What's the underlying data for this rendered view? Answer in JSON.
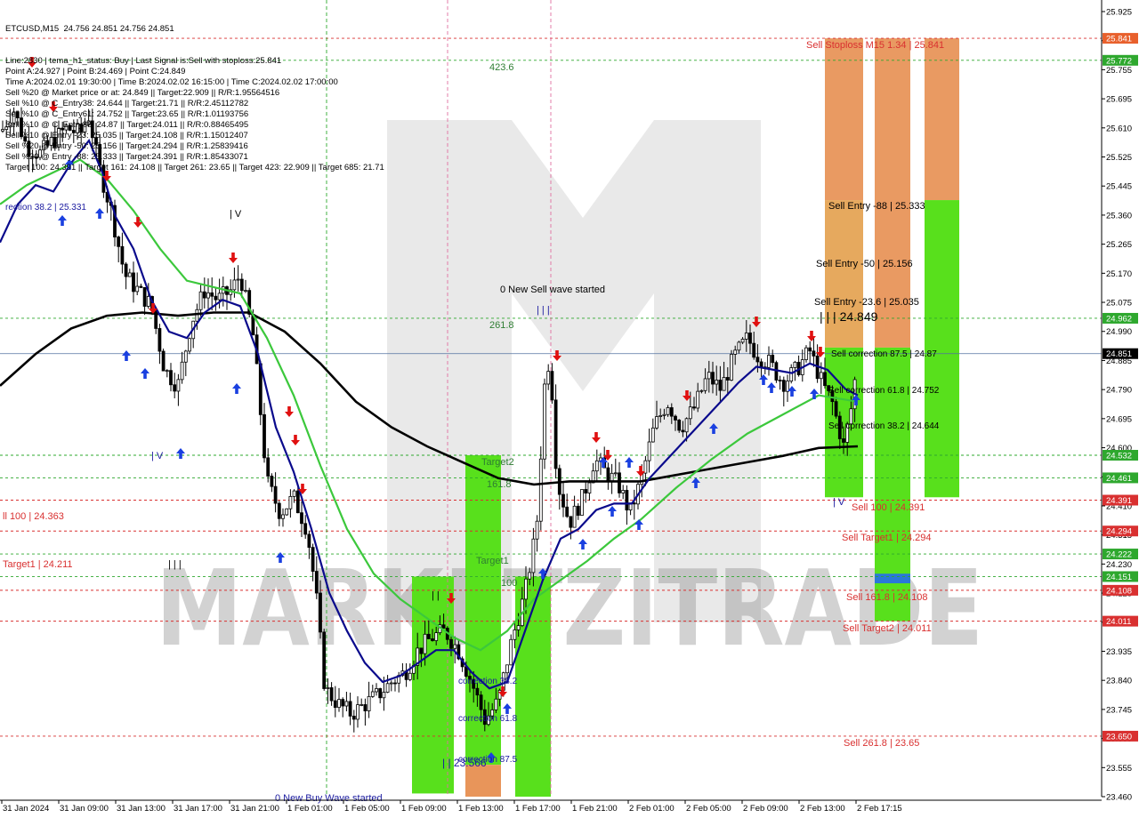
{
  "header": {
    "symbol_line": "ETCUSD,M15  24.756 24.851 24.756 24.851",
    "info_lines": [
      "Line:2830 | tema_h1_status: Buy | Last Signal is:Sell with stoploss:25.841",
      "Point A:24.927 | Point B:24.469 | Point C:24.849",
      "Time A:2024.02.01 19:30:00 | Time B:2024.02.02 16:15:00 | Time C:2024.02.02 17:00:00",
      "Sell %20 @ Market price or at: 24.849 || Target:22.909 || R/R:1.95564516",
      "Sell %10 @ C_Entry38: 24.644 || Target:21.71 || R/R:2.45112782",
      "Sell %10 @ C_Entry61: 24.752 || Target:23.65 || R/R:1.01193756",
      "Sell %10 @ C_Entry88: 24.87 || Target:24.011 || R/R:0.88465495",
      "Sell %10 @ Entry -23: 25.035 || Target:24.108 || R/R:1.15012407",
      "Sell %20 @ Entry -50: 25.156 || Target:24.294 || R/R:1.25839416",
      "Sell %20 @ Entry -88: 25.333 || Target:24.391 || R/R:1.85433071",
      "Target 100: 24.391 || Target 161: 24.108 || Target 261: 23.65 || Target 423: 22.909 || Target 685: 21.71"
    ]
  },
  "chart_data": {
    "type": "candlestick",
    "symbol": "ETCUSD",
    "timeframe": "M15",
    "ohlc_last": {
      "open": 24.756,
      "high": 24.851,
      "low": 24.756,
      "close": 24.851
    },
    "ylim": [
      23.46,
      25.97
    ],
    "y_ticks": [
      "25.925",
      "25.840",
      "25.755",
      "25.695",
      "25.610",
      "25.525",
      "25.445",
      "25.360",
      "25.265",
      "25.170",
      "25.075",
      "24.990",
      "24.885",
      "24.790",
      "24.695",
      "24.600",
      "24.505",
      "24.410",
      "24.315",
      "24.230",
      "24.125",
      "24.020",
      "23.935",
      "23.840",
      "23.745",
      "23.660",
      "23.555",
      "23.460"
    ],
    "x_ticks": [
      "31 Jan 2024",
      "31 Jan 09:00",
      "31 Jan 13:00",
      "31 Jan 17:00",
      "31 Jan 21:00",
      "1 Feb 01:00",
      "1 Feb 05:00",
      "1 Feb 09:00",
      "1 Feb 13:00",
      "1 Feb 17:00",
      "1 Feb 21:00",
      "2 Feb 01:00",
      "2 Feb 05:00",
      "2 Feb 09:00",
      "2 Feb 13:00",
      "2 Feb 17:15"
    ],
    "price_badges": [
      {
        "value": "25.841",
        "color": "#e8602c"
      },
      {
        "value": "25.772",
        "color": "#2ea82e"
      },
      {
        "value": "24.962",
        "color": "#2ea82e"
      },
      {
        "value": "24.851",
        "color": "#000000"
      },
      {
        "value": "24.532",
        "color": "#2ea82e"
      },
      {
        "value": "24.461",
        "color": "#2ea82e"
      },
      {
        "value": "24.391",
        "color": "#d93030"
      },
      {
        "value": "24.294",
        "color": "#d93030"
      },
      {
        "value": "24.222",
        "color": "#2ea82e"
      },
      {
        "value": "24.151",
        "color": "#2ea82e"
      },
      {
        "value": "24.108",
        "color": "#d93030"
      },
      {
        "value": "24.011",
        "color": "#d93030"
      },
      {
        "value": "23.650",
        "color": "#d93030"
      }
    ],
    "annotations": [
      {
        "text": "Sell Stoploss M15 1.34 | 25.841",
        "color": "#d93030"
      },
      {
        "text": "Sell Entry -88 | 25.333",
        "color": "#000000"
      },
      {
        "text": "Sell Entry -50 | 25.156",
        "color": "#000000"
      },
      {
        "text": "Sell Entry -23.6 | 25.035",
        "color": "#000000"
      },
      {
        "text": "| | | 24.849",
        "color": "#000000"
      },
      {
        "text": "Sell correction 87.5 | 24.87",
        "color": "#000000"
      },
      {
        "text": "Sell correction 61.8 | 24.752",
        "color": "#000000"
      },
      {
        "text": "Sell correction 38.2 | 24.644",
        "color": "#000000"
      },
      {
        "text": "Sell 100 | 24.391",
        "color": "#d93030"
      },
      {
        "text": "Sell Target1 | 24.294",
        "color": "#d93030"
      },
      {
        "text": "Sell 161.8 | 24.108",
        "color": "#d93030"
      },
      {
        "text": "Sell Target2 | 24.011",
        "color": "#d93030"
      },
      {
        "text": "Sell 261.8 | 23.65",
        "color": "#d93030"
      },
      {
        "text": "423.6",
        "color": "#2e7d32"
      },
      {
        "text": "261.8",
        "color": "#2e7d32"
      },
      {
        "text": "0 New Sell wave started",
        "color": "#000000"
      },
      {
        "text": "0 New Buy Wave started",
        "color": "#1a1aa0"
      },
      {
        "text": "Target2",
        "color": "#2e7d32"
      },
      {
        "text": "Target1",
        "color": "#2e7d32"
      },
      {
        "text": "161.8",
        "color": "#2e7d32"
      },
      {
        "text": "100",
        "color": "#2e7d32"
      },
      {
        "text": "correction 38.2",
        "color": "#1a1aa0"
      },
      {
        "text": "correction 61.8",
        "color": "#1a1aa0"
      },
      {
        "text": "correction 87.5",
        "color": "#1a1aa0"
      },
      {
        "text": "| | 23.566",
        "color": "#1a1aa0"
      },
      {
        "text": "rection 38.2 | 25.331",
        "color": "#1a1aa0"
      },
      {
        "text": "ll 100 | 24.363",
        "color": "#d93030"
      },
      {
        "text": "Target1 | 24.211",
        "color": "#d93030"
      },
      {
        "text": "| V",
        "color": "#1a1aa0"
      },
      {
        "text": "| V",
        "color": "#000000"
      },
      {
        "text": "| V",
        "color": "#1a1aa0"
      },
      {
        "text": "| | |",
        "color": "#1a1aa0"
      },
      {
        "text": "| | |",
        "color": "#000000"
      },
      {
        "text": "| |",
        "color": "#000000"
      }
    ],
    "watermark": "MARKETZITRADE",
    "colors": {
      "green_zone": "#58e01c",
      "orange_zone": "#e8955a",
      "ma_blue": "#0a0a8c",
      "ma_green": "#3cc83c",
      "ma_black": "#000000",
      "sell_arrow": "#e01010",
      "buy_arrow": "#1a40e0"
    }
  }
}
